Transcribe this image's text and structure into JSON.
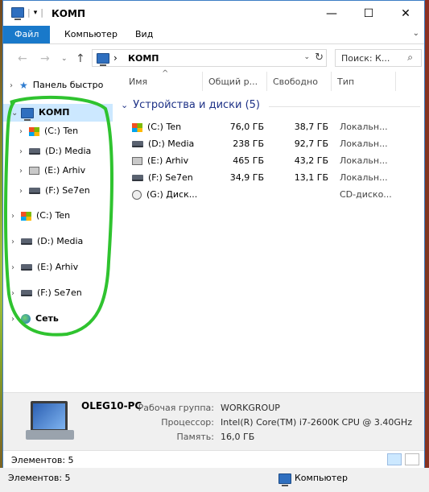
{
  "window": {
    "title": "КОМП"
  },
  "menu": {
    "file": "Файл",
    "computer": "Компьютер",
    "view": "Вид"
  },
  "address": {
    "path": "КОМП",
    "separator": "›",
    "search_placeholder": "Поиск: К..."
  },
  "nav_tree": [
    {
      "label": "Панель быстро",
      "icon": "star-icon",
      "level": 0,
      "selected": false
    },
    {
      "label": "КОМП",
      "icon": "computer-icon",
      "level": 0,
      "selected": true,
      "expanded": true
    },
    {
      "label": "(C:) Ten",
      "icon": "windows-drive-icon",
      "level": 1
    },
    {
      "label": "(D:) Media",
      "icon": "hdd-icon",
      "level": 1
    },
    {
      "label": "(E:) Arhiv",
      "icon": "archive-drive-icon",
      "level": 1
    },
    {
      "label": "(F:) Se7en",
      "icon": "hdd-icon",
      "level": 1
    },
    {
      "label": "(C:) Ten",
      "icon": "windows-drive-icon",
      "level": 0
    },
    {
      "label": "(D:) Media",
      "icon": "hdd-icon",
      "level": 0
    },
    {
      "label": "(E:) Arhiv",
      "icon": "hdd-icon",
      "level": 0
    },
    {
      "label": "(F:) Se7en",
      "icon": "hdd-icon",
      "level": 0
    },
    {
      "label": "Сеть",
      "icon": "network-icon",
      "level": 0
    }
  ],
  "columns": {
    "name": "Имя",
    "total": "Общий р...",
    "free": "Свободно",
    "type": "Тип"
  },
  "group": {
    "title": "Устройства и диски (5)"
  },
  "drives": [
    {
      "name": "(C:) Ten",
      "total": "76,0 ГБ",
      "free": "38,7 ГБ",
      "type": "Локальн...",
      "icon": "windows-drive-icon"
    },
    {
      "name": "(D:) Media",
      "total": "238 ГБ",
      "free": "92,7 ГБ",
      "type": "Локальн...",
      "icon": "hdd-icon"
    },
    {
      "name": "(E:) Arhiv",
      "total": "465 ГБ",
      "free": "43,2 ГБ",
      "type": "Локальн...",
      "icon": "archive-drive-icon"
    },
    {
      "name": "(F:) Se7en",
      "total": "34,9 ГБ",
      "free": "13,1 ГБ",
      "type": "Локальн...",
      "icon": "hdd-icon"
    },
    {
      "name": "(G:) Диск...",
      "total": "",
      "free": "",
      "type": "CD-диско...",
      "icon": "cd-drive-icon"
    }
  ],
  "details": {
    "pc_name": "OLEG10-PC",
    "workgroup_label": "Рабочая группа:",
    "workgroup_value": "WORKGROUP",
    "cpu_label": "Процессор:",
    "cpu_value": "Intel(R) Core(TM) i7-2600K CPU @ 3.40GHz",
    "memory_label": "Память:",
    "memory_value": "16,0 ГБ"
  },
  "status": {
    "items_count": "Элементов: 5"
  },
  "outer_status": {
    "items_count": "Элементов: 5",
    "location": "Компьютер"
  },
  "colors": {
    "accent": "#1979ca",
    "selection": "#cce8ff",
    "annotation": "#2fc32f"
  }
}
